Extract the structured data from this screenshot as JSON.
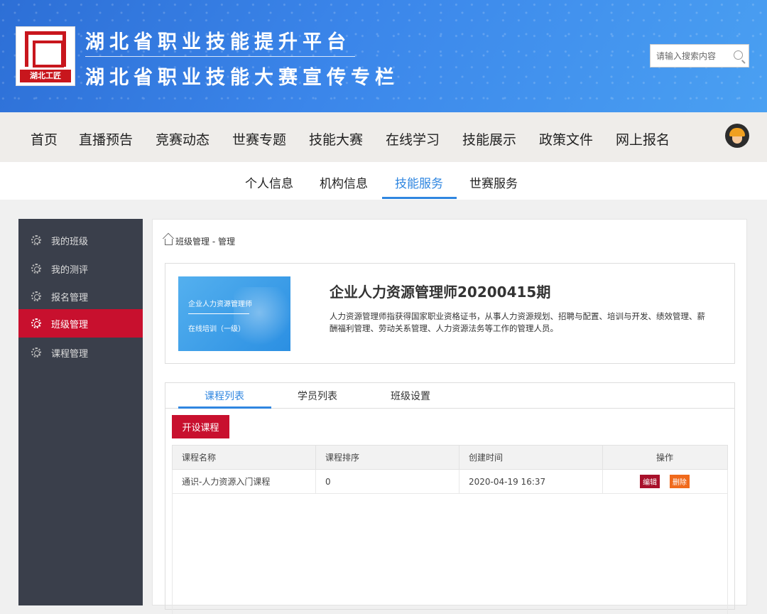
{
  "header": {
    "logo_text": "湖北工匠",
    "title_line1": "湖北省职业技能提升平台",
    "title_line2": "湖北省职业技能大赛宣传专栏",
    "search_placeholder": "请输入搜索内容"
  },
  "main_nav": [
    "首页",
    "直播预告",
    "竞赛动态",
    "世赛专题",
    "技能大赛",
    "在线学习",
    "技能展示",
    "政策文件",
    "网上报名"
  ],
  "sub_nav": {
    "items": [
      "个人信息",
      "机构信息",
      "技能服务",
      "世赛服务"
    ],
    "active": "技能服务"
  },
  "sidebar": {
    "items": [
      "我的班级",
      "我的测评",
      "报名管理",
      "班级管理",
      "课程管理"
    ],
    "active": "班级管理"
  },
  "breadcrumb": "班级管理 - 管理",
  "course": {
    "thumb_line1": "企业人力资源管理师",
    "thumb_line2": "在线培训（一级）",
    "title": "企业人力资源管理师20200415期",
    "description": "人力资源管理师指获得国家职业资格证书，从事人力资源规划、招聘与配置、培训与开发、绩效管理、薪酬福利管理、劳动关系管理、人力资源法务等工作的管理人员。"
  },
  "tabs": [
    "课程列表",
    "学员列表",
    "班级设置"
  ],
  "new_course_button": "开设课程",
  "table": {
    "headers": [
      "课程名称",
      "课程排序",
      "创建时间",
      "操作"
    ],
    "rows": [
      {
        "name": "通识-人力资源入门课程",
        "order": "0",
        "created": "2020-04-19 16:37"
      }
    ],
    "edit_label": "编辑",
    "delete_label": "删除"
  },
  "colors": {
    "banner": "#3b86ea",
    "accent_blue": "#2f86e0",
    "accent_red": "#c8102e",
    "sidebar_bg": "#3a3f4b",
    "delete_orange": "#f06a1c"
  }
}
